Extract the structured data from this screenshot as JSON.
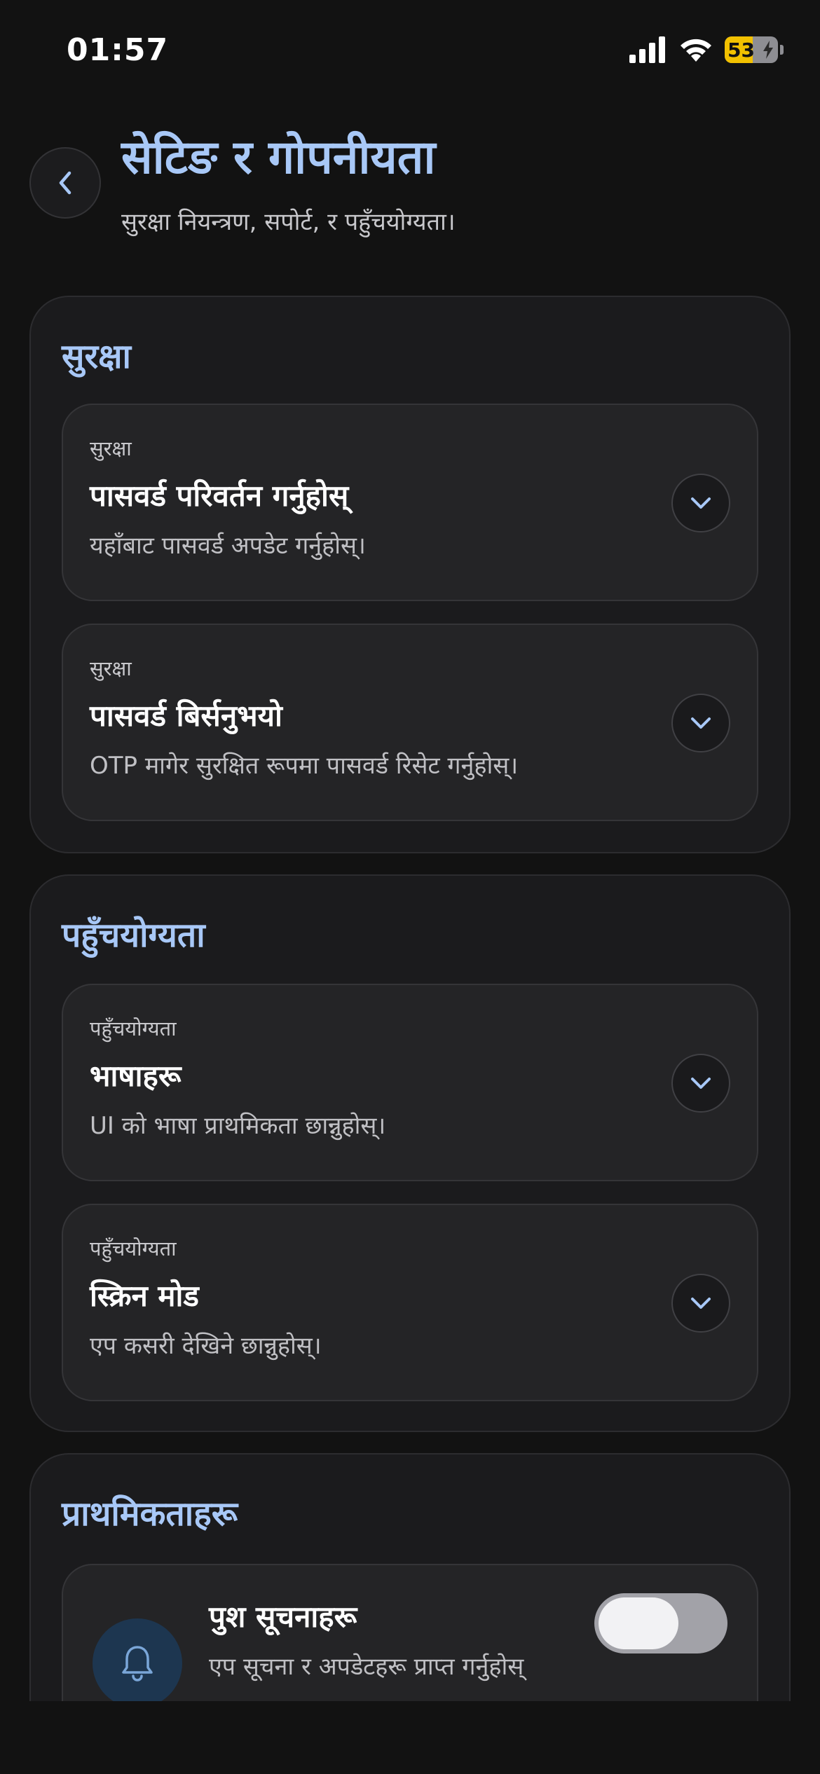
{
  "status_bar": {
    "time": "01:57",
    "battery_level": "53",
    "battery_percent": 53
  },
  "header": {
    "back_icon": "chevron-left-icon",
    "title": "सेटिङ र गोपनीयता",
    "subtitle": "सुरक्षा नियन्त्रण, सपोर्ट, र पहुँचयोग्यता।"
  },
  "sections": [
    {
      "title": "सुरक्षा",
      "items": [
        {
          "kicker": "सुरक्षा",
          "title": "पासवर्ड परिवर्तन गर्नुहोस्",
          "desc": "यहाँबाट पासवर्ड अपडेट गर्नुहोस्।"
        },
        {
          "kicker": "सुरक्षा",
          "title": "पासवर्ड बिर्सनुभयो",
          "desc": "OTP मागेर सुरक्षित रूपमा पासवर्ड रिसेट गर्नुहोस्।"
        }
      ]
    },
    {
      "title": "पहुँचयोग्यता",
      "items": [
        {
          "kicker": "पहुँचयोग्यता",
          "title": "भाषाहरू",
          "desc": "UI को भाषा प्राथमिकता छान्नुहोस्।"
        },
        {
          "kicker": "पहुँचयोग्यता",
          "title": "स्क्रिन मोड",
          "desc": "एप कसरी देखिने छान्नुहोस्।"
        }
      ]
    },
    {
      "title": "प्राथमिकताहरू",
      "push": {
        "icon": "bell-icon",
        "title": "पुश सूचनाहरू",
        "desc": "एप सूचना र अपडेटहरू प्राप्त गर्नुहोस्",
        "enabled": false
      }
    }
  ],
  "colors": {
    "accent": "#a8c8f7",
    "background": "#121212",
    "card": "#1b1b1d",
    "item": "#242426",
    "battery": "#f2c100"
  }
}
